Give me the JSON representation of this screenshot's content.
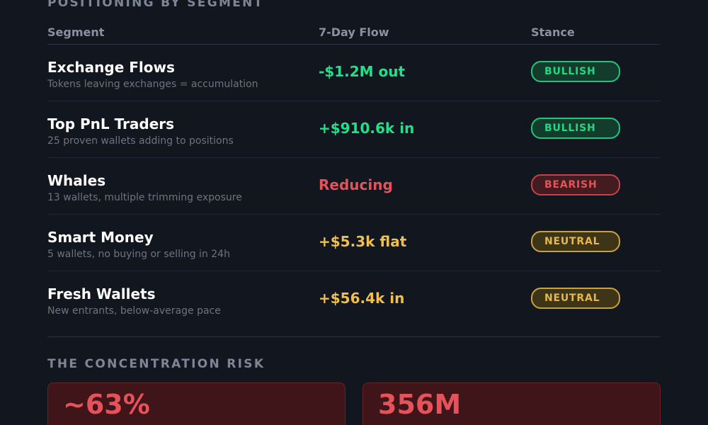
{
  "positioning": {
    "title": "POSITIONING BY SEGMENT",
    "headers": {
      "segment": "Segment",
      "flow": "7-Day Flow",
      "stance": "Stance"
    },
    "rows": [
      {
        "name": "Exchange Flows",
        "description": "Tokens leaving exchanges = accumulation",
        "flow": "-$1.2M out",
        "stance": "BULLISH"
      },
      {
        "name": "Top PnL Traders",
        "description": "25 proven wallets adding to positions",
        "flow": "+$910.6k in",
        "stance": "BULLISH"
      },
      {
        "name": "Whales",
        "description": "13 wallets, multiple trimming exposure",
        "flow": "Reducing",
        "stance": "BEARISH"
      },
      {
        "name": "Smart Money",
        "description": "5 wallets, no buying or selling in 24h",
        "flow": "+$5.3k flat",
        "stance": "NEUTRAL"
      },
      {
        "name": "Fresh Wallets",
        "description": "New entrants, below-average pace",
        "flow": "+$56.4k in",
        "stance": "NEUTRAL"
      }
    ]
  },
  "concentration": {
    "title": "THE CONCENTRATION RISK",
    "cards": [
      {
        "value": "~63%"
      },
      {
        "value": "356M"
      }
    ]
  },
  "colors": {
    "background": "#12161f",
    "bullish": "#22d884",
    "bearish": "#e5525a",
    "neutral": "#e6b847",
    "risk_card": "#3f1519"
  }
}
